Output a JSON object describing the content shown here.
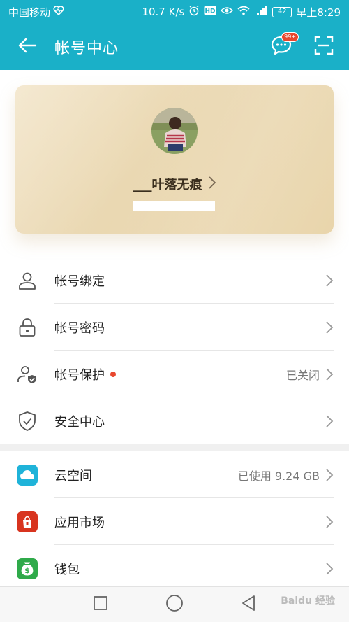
{
  "status_bar": {
    "carrier": "中国移动",
    "speed": "10.7 K/s",
    "battery": "42",
    "time": "早上8:29"
  },
  "header": {
    "title": "帐号中心",
    "badge": "99+"
  },
  "profile": {
    "username": "___叶落无痕"
  },
  "account_items": [
    {
      "label": "帐号绑定",
      "value": "",
      "icon": "person-icon"
    },
    {
      "label": "帐号密码",
      "value": "",
      "icon": "lock-icon"
    },
    {
      "label": "帐号保护",
      "value": "已关闭",
      "icon": "person-shield-icon"
    },
    {
      "label": "安全中心",
      "value": "",
      "icon": "shield-check-icon"
    }
  ],
  "service_items": [
    {
      "label": "云空间",
      "value": "已使用 9.24 GB",
      "icon": "cloud-icon",
      "color": "#1fb3d9"
    },
    {
      "label": "应用市场",
      "value": "",
      "icon": "app-market-icon",
      "color": "#d8341f"
    },
    {
      "label": "钱包",
      "value": "",
      "icon": "wallet-icon",
      "color": "#2faa4a"
    }
  ],
  "watermark": "Baidu 经验",
  "colors": {
    "primary": "#1ab0c8",
    "alert_dot": "#e8472e",
    "card_gold": "#ead8b2"
  }
}
